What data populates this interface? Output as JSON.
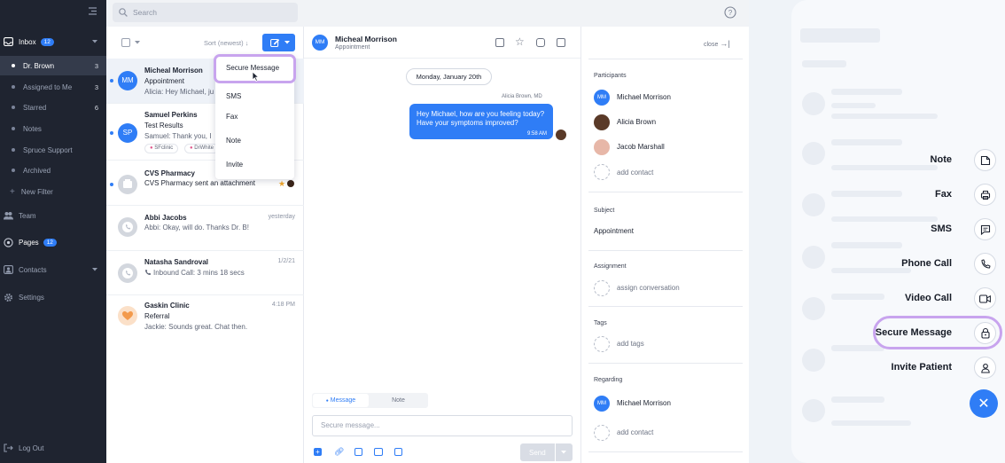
{
  "colors": {
    "nav_bg": "#1f2430",
    "accent": "#2f7df6",
    "highlight": "#c8a4ee"
  },
  "search": {
    "placeholder": "Search"
  },
  "nav": {
    "inbox": {
      "label": "Inbox",
      "count": "12"
    },
    "items": [
      {
        "label": "Dr. Brown",
        "count": "3"
      },
      {
        "label": "Assigned to Me",
        "count": "3"
      },
      {
        "label": "Starred",
        "count": "6"
      },
      {
        "label": "Notes",
        "count": ""
      },
      {
        "label": "Spruce Support",
        "count": ""
      },
      {
        "label": "Archived",
        "count": ""
      },
      {
        "label": "New Filter",
        "count": ""
      }
    ],
    "team": "Team",
    "pages": {
      "label": "Pages",
      "count": "12"
    },
    "contacts": "Contacts",
    "settings": "Settings",
    "logout": "Log Out"
  },
  "list": {
    "sort_label": "Sort (newest)",
    "conversations": [
      {
        "initials": "MM",
        "name": "Micheal Morrison",
        "line2": "Appointment",
        "line3": "Alicia: Hey Michael, ju",
        "time": ""
      },
      {
        "initials": "SP",
        "name": "Samuel Perkins",
        "line2": "Test Results",
        "line3": "Samuel: Thank you, I",
        "tags": [
          "SFclinic",
          "DrWhite"
        ],
        "time": ""
      },
      {
        "initials": "",
        "name": "CVS Pharmacy",
        "line2": "CVS Pharmacy sent an attachment",
        "line3": "",
        "time": ""
      },
      {
        "initials": "",
        "name": "Abbi Jacobs",
        "line2": "Abbi: Okay, will do. Thanks Dr. B!",
        "line3": "",
        "time": "yesterday"
      },
      {
        "initials": "",
        "name": "Natasha Sandroval",
        "line2": "Inbound Call: 3 mins 18 secs",
        "line3": "",
        "time": "1/2/21"
      },
      {
        "initials": "",
        "name": "Gaskin Clinic",
        "line2": "Referral",
        "line3": "Jackie: Sounds great. Chat then.",
        "time": "4:18 PM"
      }
    ]
  },
  "dropdown": {
    "items": [
      "Secure Message",
      "SMS",
      "Fax",
      "Note",
      "Invite"
    ]
  },
  "chat": {
    "initials": "MM",
    "name": "Micheal Morrison",
    "subtitle": "Appointment",
    "date": "Monday, January 20th",
    "sender": "Alicia Brown, MD",
    "message": "Hey Michael, how are you feeling today? Have your symptoms improved?",
    "message_time": "9:58 AM",
    "tabs": [
      "Message",
      "Note"
    ],
    "input_placeholder": "Secure message...",
    "send_label": "Send"
  },
  "details": {
    "close_label": "close",
    "participants_title": "Participants",
    "participants": [
      {
        "initials": "MM",
        "name": "Michael Morrison"
      },
      {
        "initials": "",
        "name": "Alicia Brown"
      },
      {
        "initials": "",
        "name": "Jacob Marshall"
      }
    ],
    "add_contact": "add contact",
    "subject_title": "Subject",
    "subject": "Appointment",
    "assignment_title": "Assignment",
    "assign": "assign conversation",
    "tags_title": "Tags",
    "add_tags": "add tags",
    "regarding_title": "Regarding",
    "regarding": {
      "initials": "MM",
      "name": "Michael Morrison"
    },
    "add_contact2": "add contact"
  },
  "mobile": {
    "actions": [
      "Note",
      "Fax",
      "SMS",
      "Phone Call",
      "Video Call",
      "Secure Message",
      "Invite Patient"
    ]
  }
}
